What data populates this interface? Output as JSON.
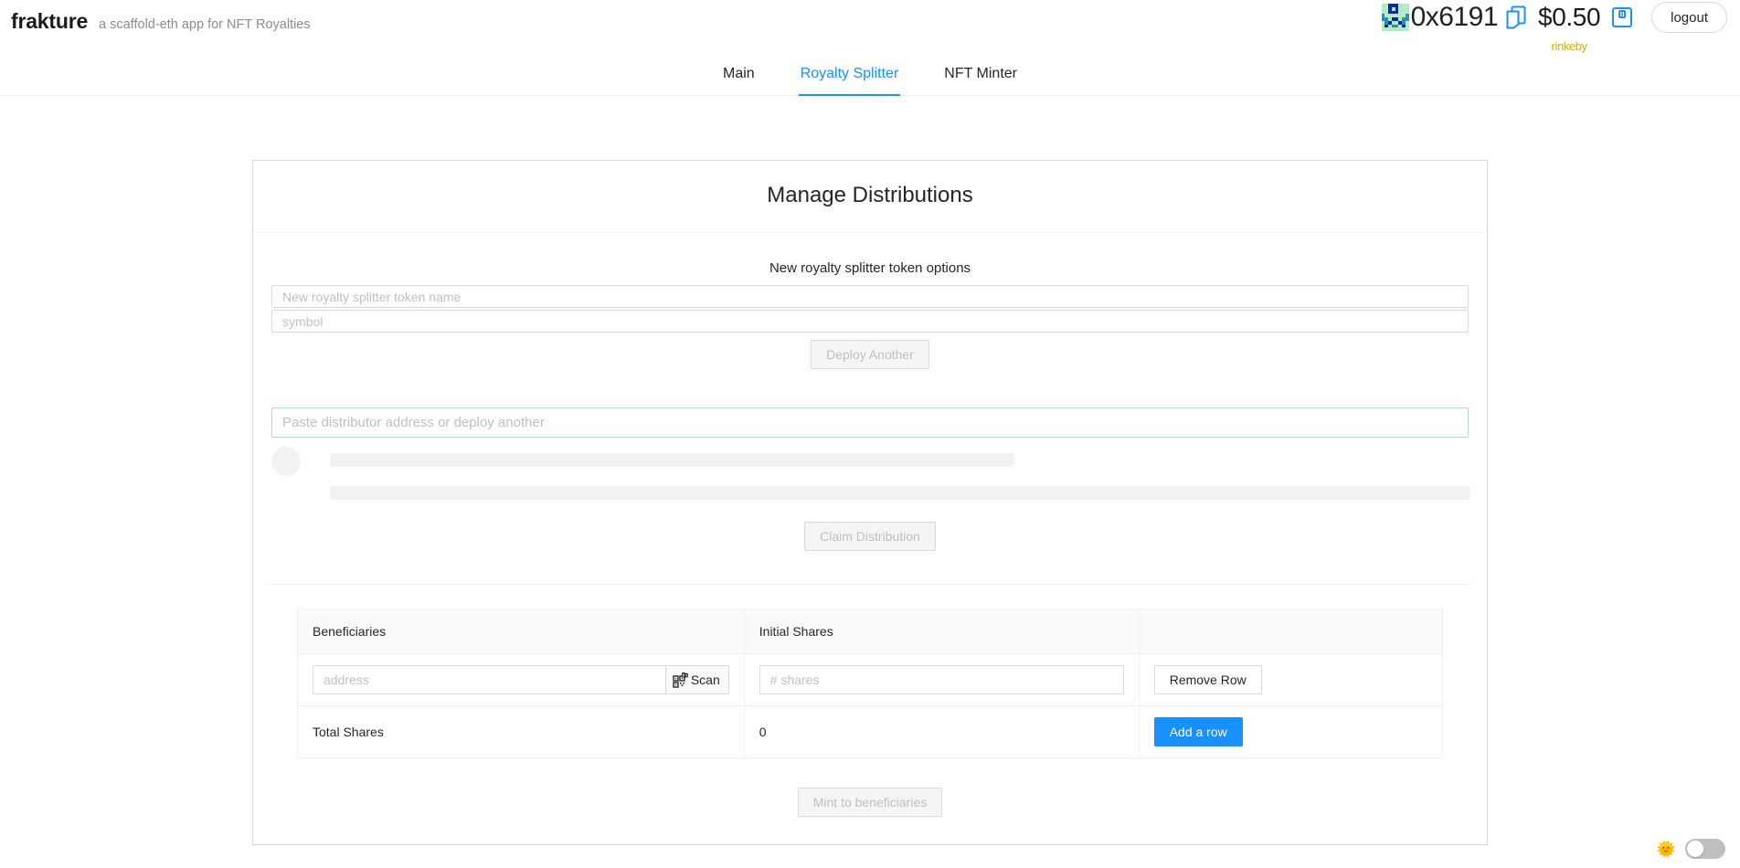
{
  "header": {
    "brand": "frakture",
    "tagline": "a scaffold-eth app for NFT Royalties",
    "address": "0x6191",
    "balance": "$0.50",
    "network": "rinkeby",
    "logout_label": "logout",
    "copy_icon": "copy-icon",
    "save_icon": "save-icon",
    "blockie_colors": {
      "bg": "#b7eac2",
      "fg": "#0a2ba8",
      "spot": "#2e8fb5"
    },
    "blockie_grid": [
      0,
      0,
      1,
      1,
      1,
      0,
      0,
      0,
      0,
      0,
      1,
      0,
      1,
      0,
      0,
      0,
      0,
      0,
      1,
      1,
      1,
      0,
      0,
      0,
      2,
      0,
      0,
      0,
      0,
      0,
      0,
      2,
      2,
      2,
      0,
      1,
      1,
      0,
      2,
      2,
      0,
      2,
      1,
      0,
      0,
      1,
      2,
      0,
      0,
      1,
      0,
      2,
      2,
      0,
      1,
      0,
      0,
      0,
      0,
      0,
      0,
      0,
      0,
      0
    ]
  },
  "tabs": [
    {
      "label": "Main",
      "active": false
    },
    {
      "label": "Royalty Splitter",
      "active": true
    },
    {
      "label": "NFT Minter",
      "active": false
    }
  ],
  "card": {
    "title": "Manage Distributions",
    "token_options_label": "New royalty splitter token options",
    "token_name_placeholder": "New royalty splitter token name",
    "symbol_placeholder": "symbol",
    "token_name_value": "",
    "symbol_value": "",
    "deploy_label": "Deploy Another",
    "distributor_placeholder": "Paste distributor address or deploy another",
    "distributor_value": "",
    "claim_label": "Claim Distribution",
    "mint_label": "Mint to beneficiaries"
  },
  "table": {
    "columns": [
      "Beneficiaries",
      "Initial Shares",
      ""
    ],
    "rows": [
      {
        "address_placeholder": "address",
        "address_value": "",
        "scan_label": "Scan",
        "scan_icon": "qr-scan-icon",
        "shares_placeholder": "# shares",
        "shares_value": "",
        "remove_label": "Remove Row"
      }
    ],
    "total_label": "Total Shares",
    "total_value": "0",
    "add_row_label": "Add a row"
  },
  "theme": {
    "sun_icon": "sun-icon",
    "toggle_on": false
  },
  "colors": {
    "accent": "#1890ff",
    "network": "#d4b106",
    "muted": "#bfbfbf",
    "border": "#d9d9d9"
  }
}
